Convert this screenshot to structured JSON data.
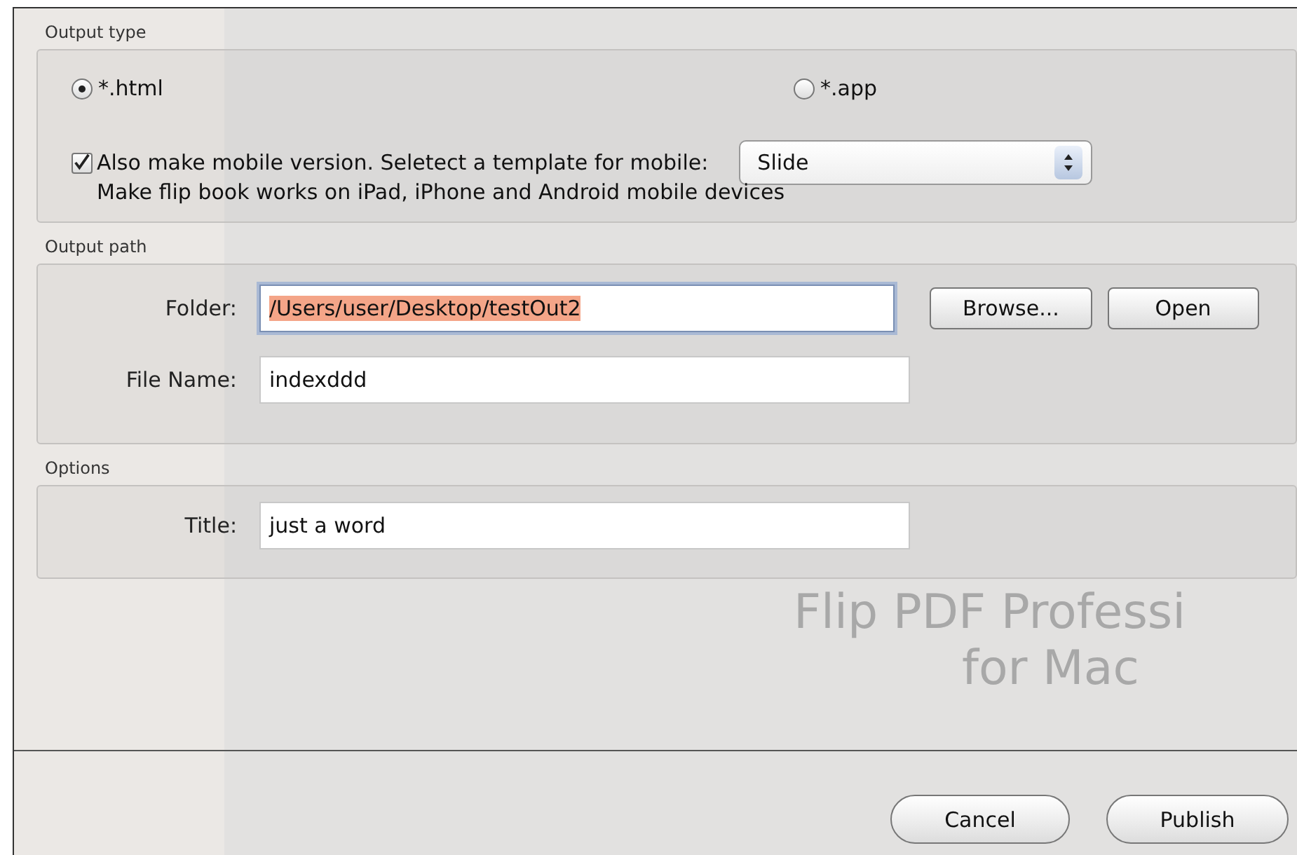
{
  "sections": [
    {
      "kind": "output_type",
      "title": "Output type",
      "radios": [
        {
          "label": "*.html",
          "selected": true
        },
        {
          "label": "*.app",
          "selected": false
        }
      ],
      "mobile": {
        "checked": true,
        "label": "Also make mobile version. Seletect a template for mobile:",
        "template": "Slide",
        "note": "Make flip book works on iPad, iPhone and Android mobile devices"
      }
    },
    {
      "kind": "output_path",
      "title": "Output path",
      "folder": {
        "label": "Folder:",
        "value": "/Users/user/Desktop/testOut2"
      },
      "buttons": [
        "Browse...",
        "Open"
      ],
      "file_name": {
        "label": "File Name:",
        "value": "indexddd"
      }
    },
    {
      "kind": "options",
      "title": "Options",
      "title_field": {
        "label": "Title:",
        "value": "just a word"
      }
    }
  ],
  "background_texts": [
    "Flip PDF Professi",
    "for Mac"
  ],
  "buttons": [
    "Cancel",
    "Publish"
  ]
}
